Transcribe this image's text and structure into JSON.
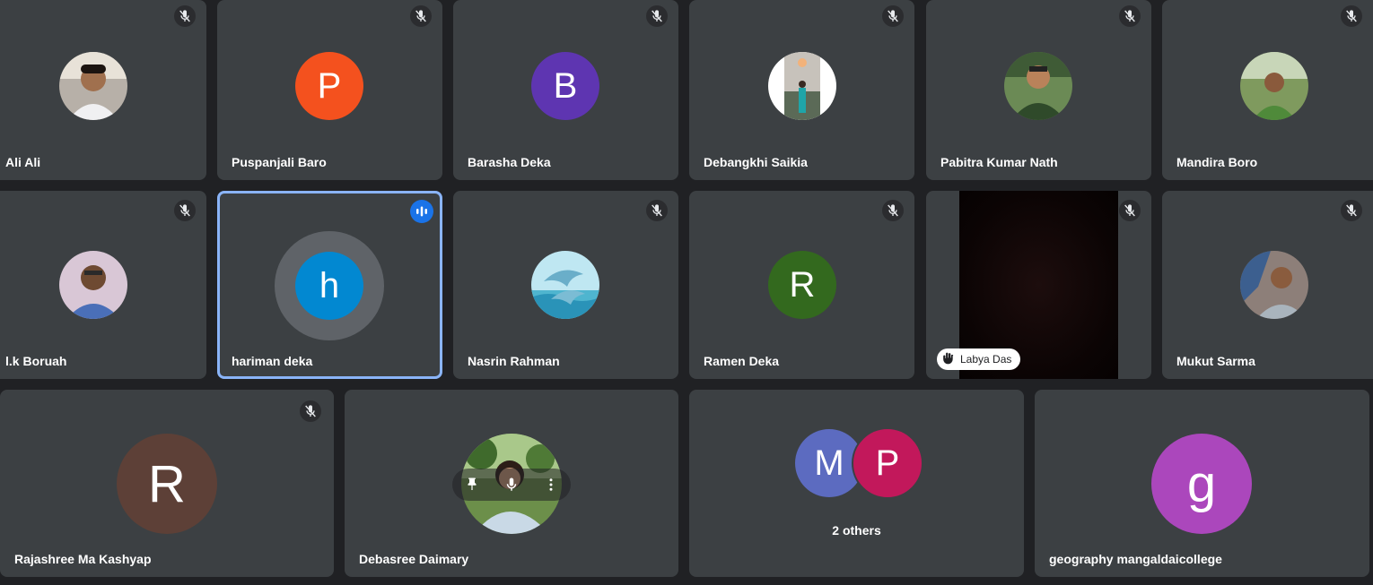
{
  "meeting": {
    "colors": {
      "background": "#202124",
      "tile": "#3c4043",
      "speaking_outline": "#8ab4f8",
      "speaking_badge": "#1a73e8"
    },
    "participants": [
      {
        "name": "Ali Ali",
        "muted": true,
        "avatar": "photo"
      },
      {
        "name": "Puspanjali Baro",
        "muted": true,
        "initial": "P",
        "color": "#f4511e"
      },
      {
        "name": "Barasha Deka",
        "muted": true,
        "initial": "B",
        "color": "#5e35b1"
      },
      {
        "name": "Debangkhi Saikia",
        "muted": true,
        "avatar": "photo"
      },
      {
        "name": "Pabitra Kumar Nath",
        "muted": true,
        "avatar": "photo"
      },
      {
        "name": "Mandira Boro",
        "muted": true,
        "avatar": "photo"
      },
      {
        "name": "l.k Boruah",
        "muted": true,
        "avatar": "photo"
      },
      {
        "name": "hariman deka",
        "muted": false,
        "speaking": true,
        "initial": "h",
        "color": "#0288d1"
      },
      {
        "name": "Nasrin Rahman",
        "muted": true,
        "avatar": "photo"
      },
      {
        "name": "Ramen Deka",
        "muted": true,
        "initial": "R",
        "color": "#33691e"
      },
      {
        "name": "Labya Das",
        "muted": true,
        "video": true,
        "raised_hand": true
      },
      {
        "name": "Mukut Sarma",
        "muted": true,
        "avatar": "photo"
      },
      {
        "name": "Rajashree Ma Kashyap",
        "muted": true,
        "initial": "R",
        "color": "#5d4037"
      },
      {
        "name": "Debasree Daimary",
        "avatar": "photo",
        "hover_controls": [
          "pin-icon",
          "mic-icon",
          "more-vert-icon"
        ]
      },
      {
        "group": true,
        "label": "2 others",
        "initials": [
          "M",
          "P"
        ],
        "colors": [
          "#5c6bc0",
          "#c2185b"
        ]
      },
      {
        "name": "geography mangaldaicollege",
        "initial": "g",
        "color": "#ab47bc"
      }
    ]
  }
}
